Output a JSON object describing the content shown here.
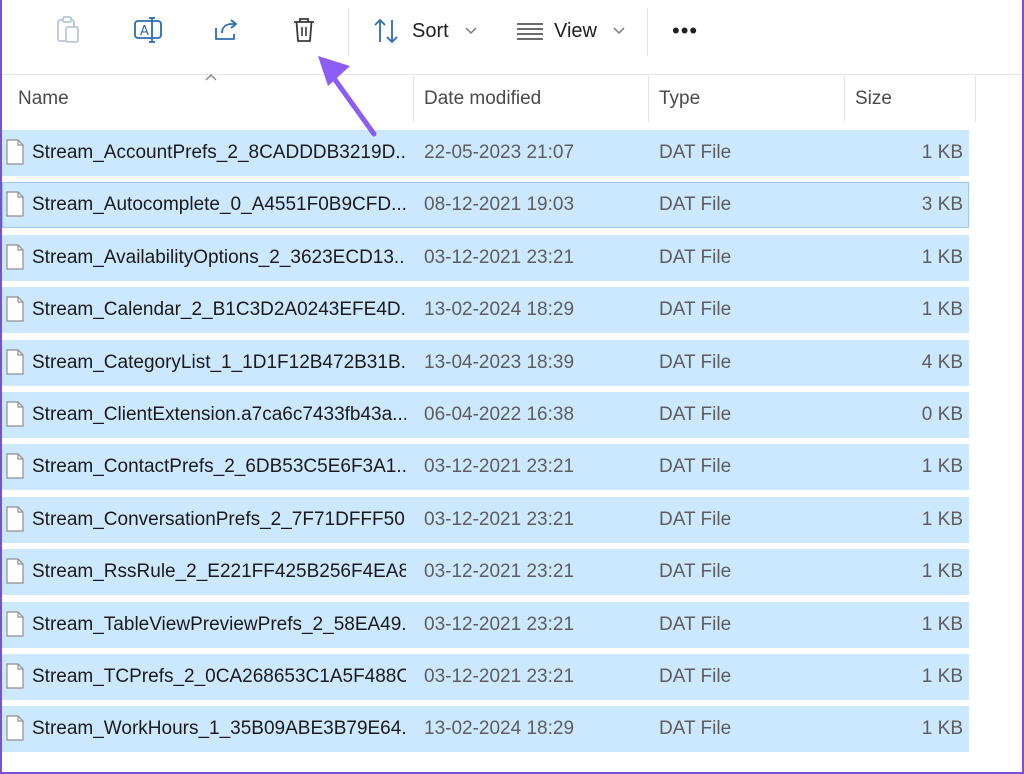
{
  "toolbar": {
    "icons": [
      "paste-icon",
      "rename-icon",
      "share-icon",
      "delete-icon"
    ],
    "sort_label": "Sort",
    "view_label": "View",
    "more_label": "•••"
  },
  "columns": {
    "name": "Name",
    "date": "Date modified",
    "type": "Type",
    "size": "Size"
  },
  "files": [
    {
      "name": "Stream_AccountPrefs_2_8CADDDB3219D...",
      "date": "22-05-2023 21:07",
      "type": "DAT File",
      "size": "1 KB"
    },
    {
      "name": "Stream_Autocomplete_0_A4551F0B9CFD...",
      "date": "08-12-2021 19:03",
      "type": "DAT File",
      "size": "3 KB"
    },
    {
      "name": "Stream_AvailabilityOptions_2_3623ECD13...",
      "date": "03-12-2021 23:21",
      "type": "DAT File",
      "size": "1 KB"
    },
    {
      "name": "Stream_Calendar_2_B1C3D2A0243EFE4D...",
      "date": "13-02-2024 18:29",
      "type": "DAT File",
      "size": "1 KB"
    },
    {
      "name": "Stream_CategoryList_1_1D1F12B472B31B...",
      "date": "13-04-2023 18:39",
      "type": "DAT File",
      "size": "4 KB"
    },
    {
      "name": "Stream_ClientExtension.a7ca6c7433fb43a...",
      "date": "06-04-2022 16:38",
      "type": "DAT File",
      "size": "0 KB"
    },
    {
      "name": "Stream_ContactPrefs_2_6DB53C5E6F3A1...",
      "date": "03-12-2021 23:21",
      "type": "DAT File",
      "size": "1 KB"
    },
    {
      "name": "Stream_ConversationPrefs_2_7F71DFFF50...",
      "date": "03-12-2021 23:21",
      "type": "DAT File",
      "size": "1 KB"
    },
    {
      "name": "Stream_RssRule_2_E221FF425B256F4EA8...",
      "date": "03-12-2021 23:21",
      "type": "DAT File",
      "size": "1 KB"
    },
    {
      "name": "Stream_TableViewPreviewPrefs_2_58EA49...",
      "date": "03-12-2021 23:21",
      "type": "DAT File",
      "size": "1 KB"
    },
    {
      "name": "Stream_TCPrefs_2_0CA268653C1A5F488C...",
      "date": "03-12-2021 23:21",
      "type": "DAT File",
      "size": "1 KB"
    },
    {
      "name": "Stream_WorkHours_1_35B09ABE3B79E64...",
      "date": "13-02-2024 18:29",
      "type": "DAT File",
      "size": "1 KB"
    }
  ],
  "colors": {
    "selection": "#cce8ff",
    "annotation_arrow": "#8b5cf6"
  }
}
